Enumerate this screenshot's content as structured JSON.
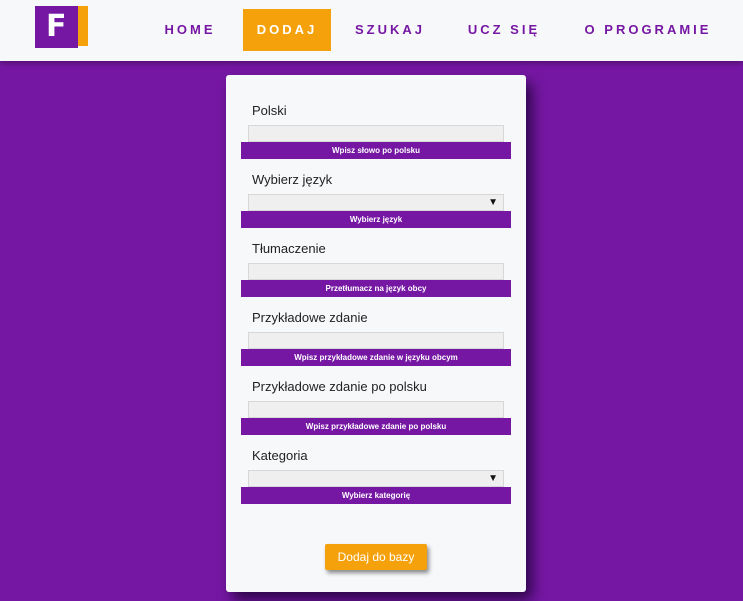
{
  "logo": {
    "letter": "F"
  },
  "nav": {
    "home": "HOME",
    "dodaj": "DODAJ",
    "szukaj": "SZUKAJ",
    "ucz": "UCZ SIĘ",
    "about": "O PROGRAMIE"
  },
  "form": {
    "polski": {
      "label": "Polski",
      "value": "",
      "hint": "Wpisz słowo po polsku"
    },
    "jezyk": {
      "label": "Wybierz język",
      "value": "",
      "hint": "Wybierz język"
    },
    "tlumaczenie": {
      "label": "Tłumaczenie",
      "value": "",
      "hint": "Przetłumacz na język obcy"
    },
    "zdanie": {
      "label": "Przykładowe zdanie",
      "value": "",
      "hint": "Wpisz przykładowe zdanie w języku obcym"
    },
    "zdanie_pl": {
      "label": "Przykładowe zdanie po polsku",
      "value": "",
      "hint": "Wpisz przykładowe zdanie po polsku"
    },
    "kategoria": {
      "label": "Kategoria",
      "value": "",
      "hint": "Wybierz kategorię"
    },
    "submit": "Dodaj do bazy"
  },
  "colors": {
    "purple": "#7617a4",
    "orange": "#f5a10b",
    "card": "#f7f8fa"
  },
  "icons": {
    "select_arrow": "▼"
  }
}
